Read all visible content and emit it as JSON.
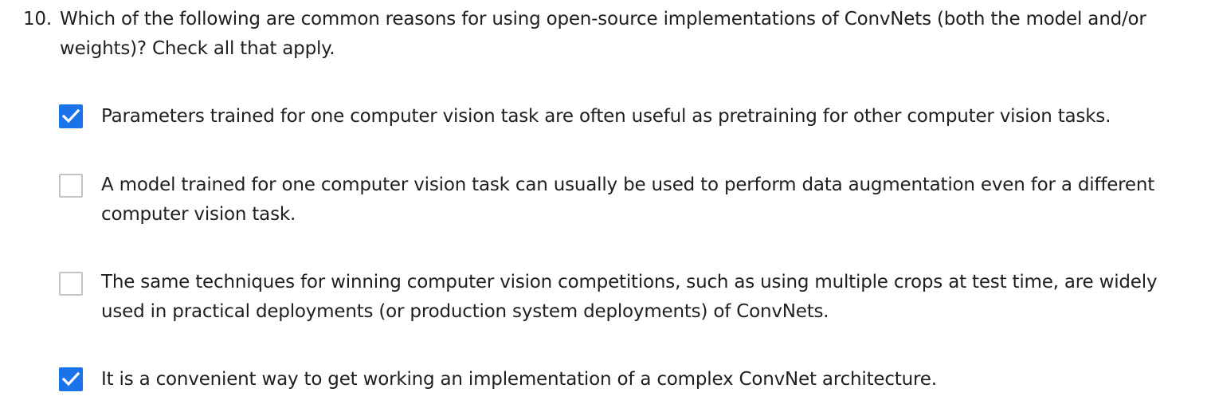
{
  "question": {
    "number": "10.",
    "prompt": "Which of the following are common reasons for using open-source implementations of ConvNets (both the model and/or weights)? Check all that apply."
  },
  "options": [
    {
      "label": "Parameters trained for one computer vision task are often useful as pretraining for other computer vision tasks.",
      "checked": true
    },
    {
      "label": "A model trained for one computer vision task can usually be used to perform data augmentation even for a different computer vision task.",
      "checked": false
    },
    {
      "label": "The same techniques for winning computer vision competitions, such as using multiple crops at test time, are widely used in practical deployments (or production system deployments) of ConvNets.",
      "checked": false
    },
    {
      "label": "It is a convenient way to get working an implementation of a complex ConvNet architecture.",
      "checked": true
    }
  ],
  "colors": {
    "checked": "#1a73e8",
    "unchecked_border": "#c4c4c4",
    "text": "#1f1f1f"
  }
}
